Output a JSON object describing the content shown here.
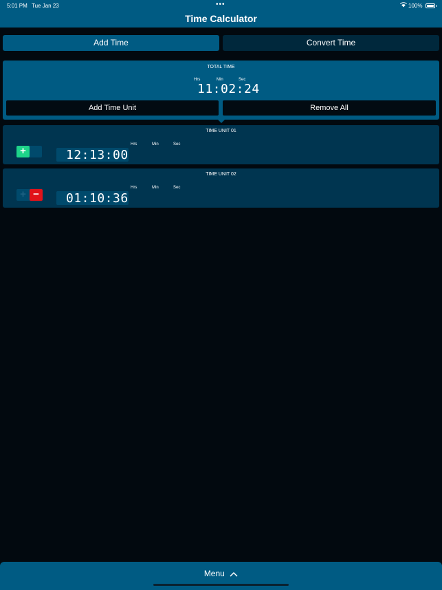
{
  "status": {
    "time": "5:01 PM",
    "date": "Tue Jan 23",
    "battery": "100%"
  },
  "nav": {
    "title": "Time Calculator"
  },
  "segments": [
    {
      "label": "Add Time"
    },
    {
      "label": "Convert Time"
    }
  ],
  "total": {
    "label": "TOTAL TIME",
    "units": [
      "Hrs",
      "Min",
      "Sec"
    ],
    "value": "11:02:24",
    "add_button": "Add Time Unit",
    "remove_button": "Remove All"
  },
  "time_units": [
    {
      "label": "TIME UNIT 01",
      "units": [
        "Hrs",
        "Min",
        "Sec"
      ],
      "value": "12:13:00"
    },
    {
      "label": "TIME UNIT 02",
      "units": [
        "Hrs",
        "Min",
        "Sec"
      ],
      "value": "01:10:36"
    }
  ],
  "bottom": {
    "menu_label": "Menu"
  },
  "colors": {
    "accent": "#005b83",
    "add": "#1ed48a",
    "remove": "#e1131a",
    "background": "#02090f"
  }
}
